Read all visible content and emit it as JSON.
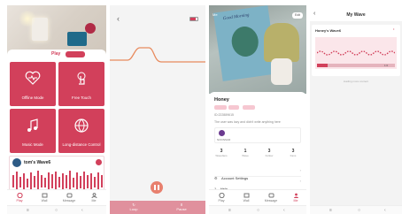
{
  "play_home": {
    "play_label": "Play",
    "tiles": [
      "Offline Mode",
      "Free Touch",
      "Music Mode",
      "Long-distance Control"
    ],
    "wave_card_title": "tom's Wave6",
    "nav": [
      "Play",
      "Wall",
      "Message",
      "Me"
    ]
  },
  "control": {
    "buttons": [
      "Loop",
      "Pause"
    ]
  },
  "profile": {
    "book_title": "Good Morning",
    "edit_label": "Edit",
    "name": "Honey",
    "id_text": "ID:222889615",
    "bio": "The user was lazy and didn't write anything here",
    "device_label": "NOONSUR",
    "stats": [
      {
        "value": "3",
        "label": "Wavefans"
      },
      {
        "value": "1",
        "label": "Wave"
      },
      {
        "value": "3",
        "label": "Follow"
      },
      {
        "value": "3",
        "label": "Fans"
      }
    ],
    "settings": [
      {
        "label": "Account Settings"
      },
      {
        "label": "Help"
      }
    ],
    "nav": [
      "Play",
      "Wall",
      "Message",
      "Me"
    ]
  },
  "my_wave": {
    "title": "My Wave",
    "card_title": "Honey's Wave6",
    "right_label": "1:0",
    "footer": "loading more content"
  }
}
